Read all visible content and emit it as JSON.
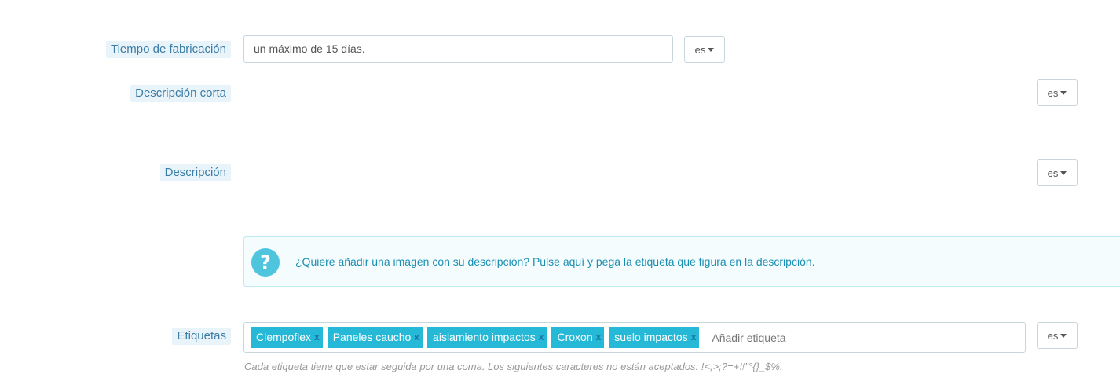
{
  "fields": {
    "manufacturing_time": {
      "label": "Tiempo de fabricación",
      "value": "un máximo de 15 días.",
      "lang": "es"
    },
    "short_description": {
      "label": "Descripción corta",
      "lang": "es"
    },
    "description": {
      "label": "Descripción",
      "lang": "es"
    },
    "tags": {
      "label": "Etiquetas",
      "items": [
        {
          "text": "Clempoflex",
          "remove": "x"
        },
        {
          "text": "Paneles caucho",
          "remove": "x"
        },
        {
          "text": "aislamiento impactos",
          "remove": "x"
        },
        {
          "text": "Croxon",
          "remove": "x"
        },
        {
          "text": "suelo impactos",
          "remove": "x"
        }
      ],
      "placeholder": "Añadir etiqueta",
      "lang": "es",
      "help": "Cada etiqueta tiene que estar seguida por una coma. Los siguientes caracteres no están aceptados: !<;>;?=+#\"°{}_$%."
    }
  },
  "info": {
    "icon": "?",
    "text": "¿Quiere añadir una imagen con su descripción? Pulse aquí y pega la etiqueta que figura en la descripción."
  },
  "colors": {
    "label_bg": "#e9f4fa",
    "label_text": "#3a7ca5",
    "tag_bg": "#25b9d7",
    "info_bg": "#f4fcfe",
    "info_icon": "#4ec4dd"
  }
}
